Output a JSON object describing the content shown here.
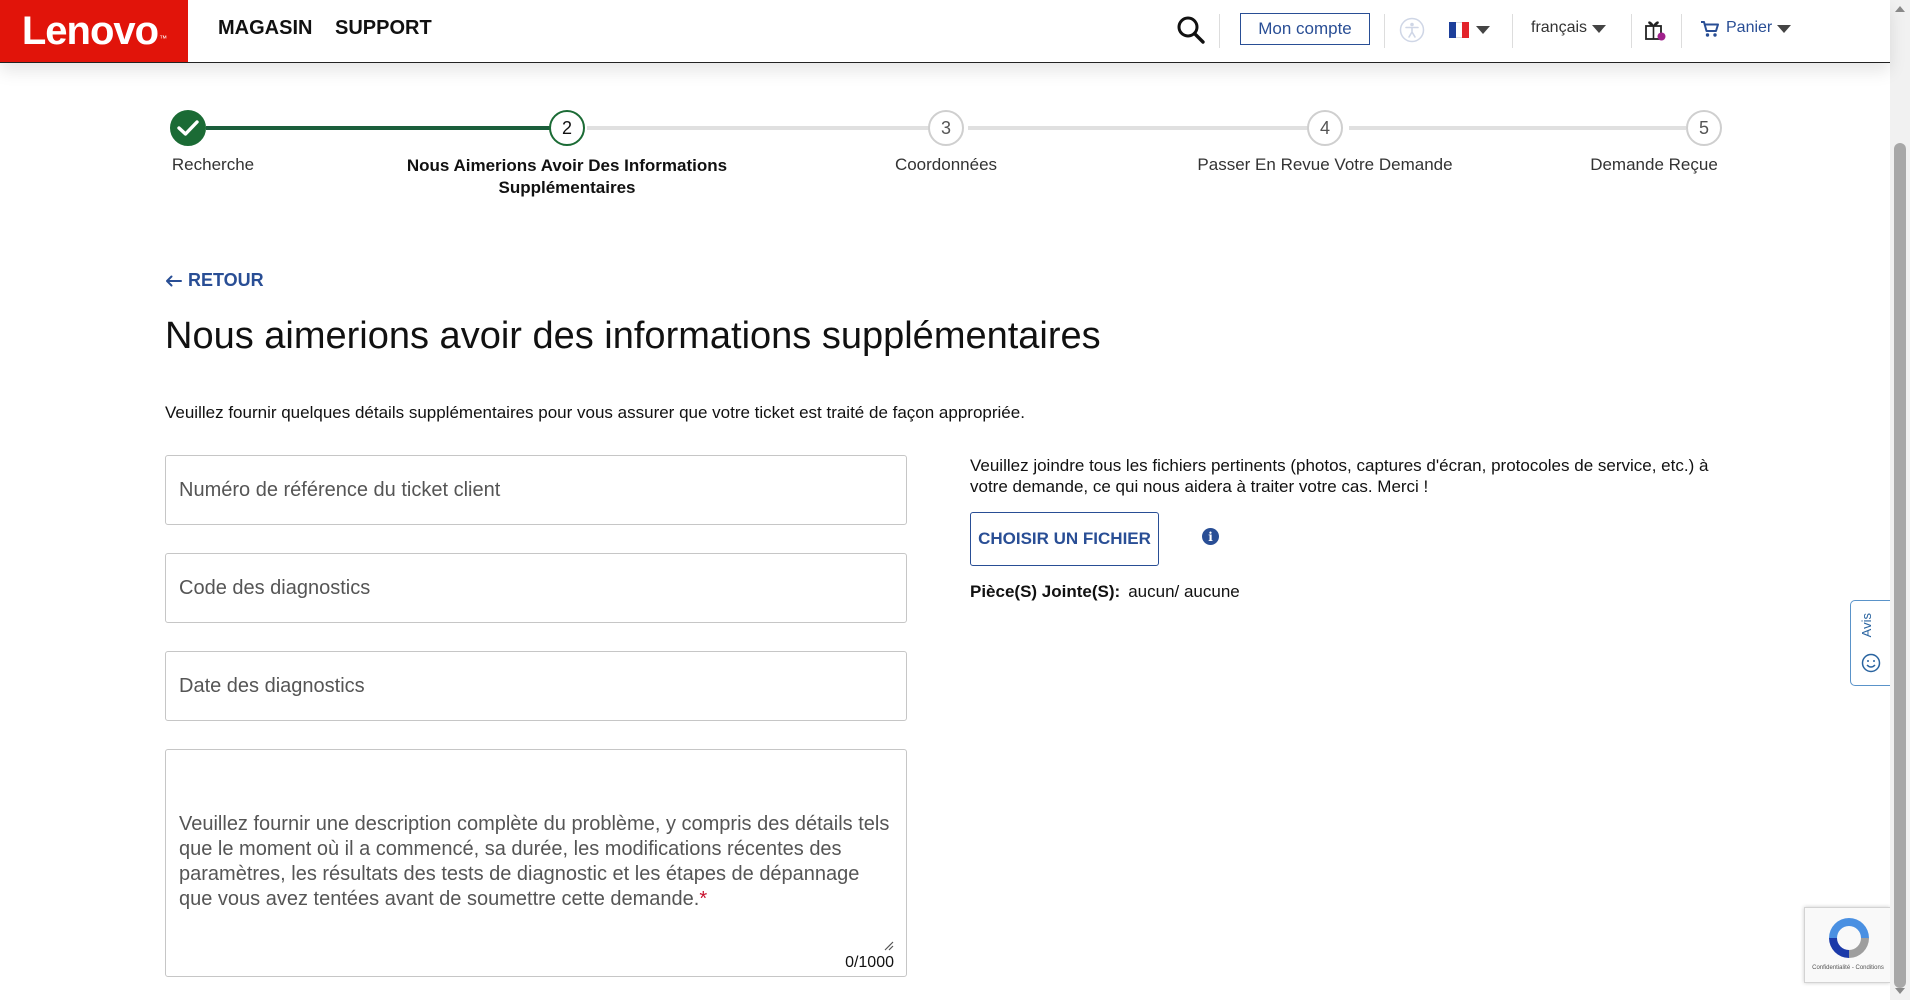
{
  "header": {
    "logo_text": "Lenovo",
    "logo_mark": "™",
    "nav": [
      {
        "label": "MAGASIN"
      },
      {
        "label": "SUPPORT"
      }
    ],
    "account_label": "Mon compte",
    "language_label": "français",
    "cart_label": "Panier",
    "icons": [
      "search-icon",
      "accessibility-icon",
      "flag-fr-icon",
      "gift-icon",
      "cart-icon"
    ]
  },
  "stepper": {
    "steps": [
      {
        "number": "1",
        "label": "Recherche",
        "state": "done"
      },
      {
        "number": "2",
        "label_line1": "Nous Aimerions Avoir Des Informations",
        "label_line2": "Supplémentaires",
        "state": "active"
      },
      {
        "number": "3",
        "label": "Coordonnées",
        "state": "pending"
      },
      {
        "number": "4",
        "label": "Passer En Revue Votre Demande",
        "state": "pending"
      },
      {
        "number": "5",
        "label": "Demande Reçue",
        "state": "pending"
      }
    ]
  },
  "content": {
    "back_label": "RETOUR",
    "title": "Nous aimerions avoir des informations supplémentaires",
    "intro": "Veuillez fournir quelques détails supplémentaires pour vous assurer que votre ticket est traité de façon appropriée.",
    "fields": {
      "reference": {
        "placeholder": "Numéro de référence du ticket client",
        "value": ""
      },
      "diag_code": {
        "placeholder": "Code des diagnostics",
        "value": ""
      },
      "diag_date": {
        "placeholder": "Date des diagnostics",
        "value": ""
      }
    },
    "description": {
      "hint": "Veuillez fournir une description complète du problème, y compris des détails tels que le moment où il a commencé, sa durée, les modifications récentes des paramètres, les résultats des tests de diagnostic et les étapes de dépannage que vous avez tentées avant de soumettre cette demande.",
      "required_mark": "*",
      "counter": "0/1000"
    },
    "attachments": {
      "instructions": "Veuillez joindre tous les fichiers pertinents (photos, captures d'écran, protocoles de service, etc.) à votre demande, ce qui nous aidera à traiter votre cas. Merci !",
      "button_label": "CHOISIR UN FICHIER",
      "status_label": "Pièce(S) Jointe(S):",
      "status_value": "aucun/ aucune"
    }
  },
  "feedback": {
    "label": "Avis"
  },
  "recaptcha": {
    "links": "Confidentialité - Conditions"
  },
  "colors": {
    "brand_red": "#e1140a",
    "link_blue": "#294e95",
    "step_green": "#1b6b35"
  }
}
